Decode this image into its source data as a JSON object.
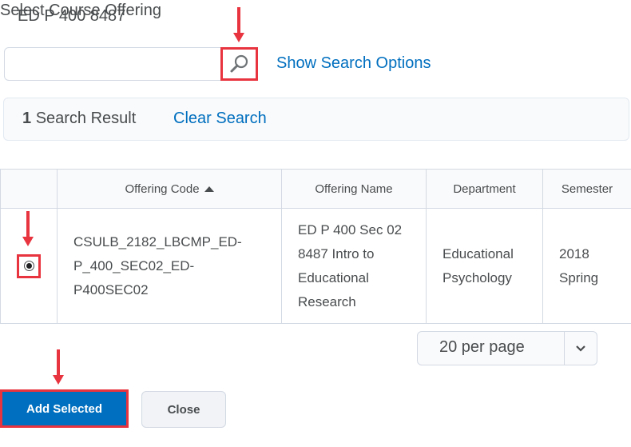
{
  "page": {
    "title": "Select Course Offering"
  },
  "search": {
    "value": "ED P 400 8487",
    "show_options_label": "Show Search Options"
  },
  "results": {
    "count": "1",
    "label": "Search Result",
    "clear_label": "Clear Search"
  },
  "table": {
    "headers": {
      "code": "Offering Code",
      "name": "Offering Name",
      "department": "Department",
      "semester": "Semester"
    },
    "rows": [
      {
        "selected": true,
        "code_lines": [
          "CSULB_2182_LBCMP_ED-",
          "P_400_SEC02_ED-",
          "P400SEC02"
        ],
        "name_lines": [
          "ED P 400 Sec 02",
          "8487 Intro to",
          "Educational",
          "Research"
        ],
        "department_lines": [
          "Educational",
          "Psychology"
        ],
        "semester_lines": [
          "2018",
          "Spring"
        ]
      }
    ]
  },
  "pagination": {
    "per_page_label": "20 per page"
  },
  "actions": {
    "add_selected_label": "Add Selected",
    "close_label": "Close"
  },
  "colors": {
    "accent": "#006fbf",
    "annotation": "#e8343f"
  },
  "icons": {
    "search": "magnifier-icon",
    "sort": "sort-ascending-icon",
    "dropdown": "chevron-down-icon"
  }
}
